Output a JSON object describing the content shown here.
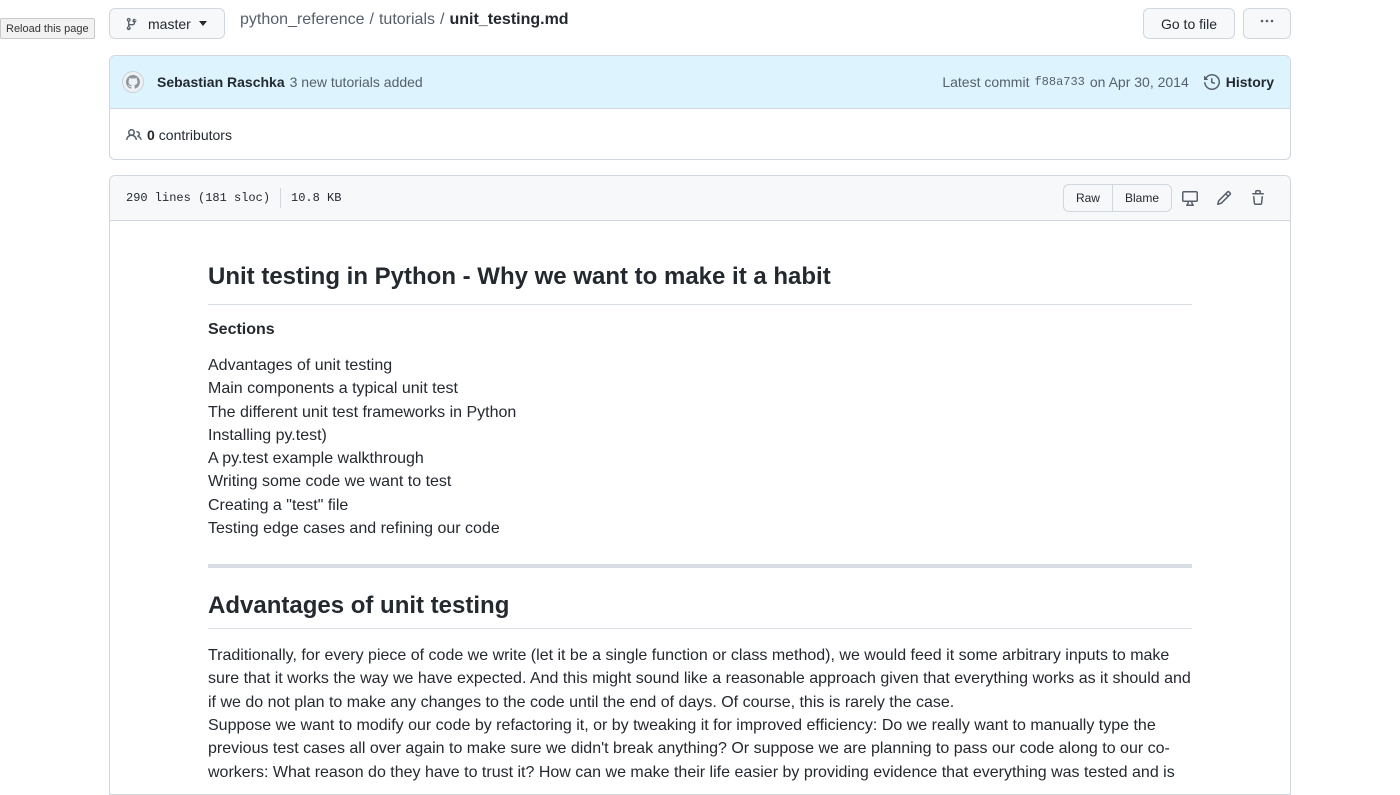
{
  "tooltip": {
    "text": "Reload this page"
  },
  "branch": {
    "name": "master"
  },
  "breadcrumb": {
    "repo": "python_reference",
    "folder": "tutorials",
    "file": "unit_testing.md",
    "separator": "/"
  },
  "toolbar": {
    "goto_label": "Go to file"
  },
  "commit": {
    "author": "Sebastian Raschka",
    "message": "3 new tutorials added",
    "latest_label": "Latest commit",
    "sha": "f88a733",
    "date": "on Apr 30, 2014",
    "history_label": "History"
  },
  "contributors": {
    "count": "0",
    "label": "contributors"
  },
  "file": {
    "lines": "290 lines (181 sloc)",
    "size": "10.8 KB",
    "raw_label": "Raw",
    "blame_label": "Blame"
  },
  "doc": {
    "title": "Unit testing in Python - Why we want to make it a habit",
    "sections_heading": "Sections",
    "sections": [
      "Advantages of unit testing",
      "Main components a typical unit test",
      "The different unit test frameworks in Python",
      "Installing py.test)",
      "A py.test example walkthrough",
      "Writing some code we want to test",
      "Creating a \"test\" file",
      "Testing edge cases and refining our code"
    ],
    "h2": "Advantages of unit testing",
    "para1": "Traditionally, for every piece of code we write (let it be a single function or class method), we would feed it some arbitrary inputs to make sure that it works the way we have expected. And this might sound like a reasonable approach given that everything works as it should and if we do not plan to make any changes to the code until the end of days. Of course, this is rarely the case.",
    "para2": "Suppose we want to modify our code by refactoring it, or by tweaking it for improved efficiency: Do we really want to manually type the previous test cases all over again to make sure we didn't break anything? Or suppose we are planning to pass our code along to our co-workers: What reason do they have to trust it? How can we make their life easier by providing evidence that everything was tested and is"
  },
  "colors": {
    "accent_bg": "#ddf4ff",
    "border": "#d0d7de",
    "text": "#24292f",
    "muted": "#57606a"
  }
}
